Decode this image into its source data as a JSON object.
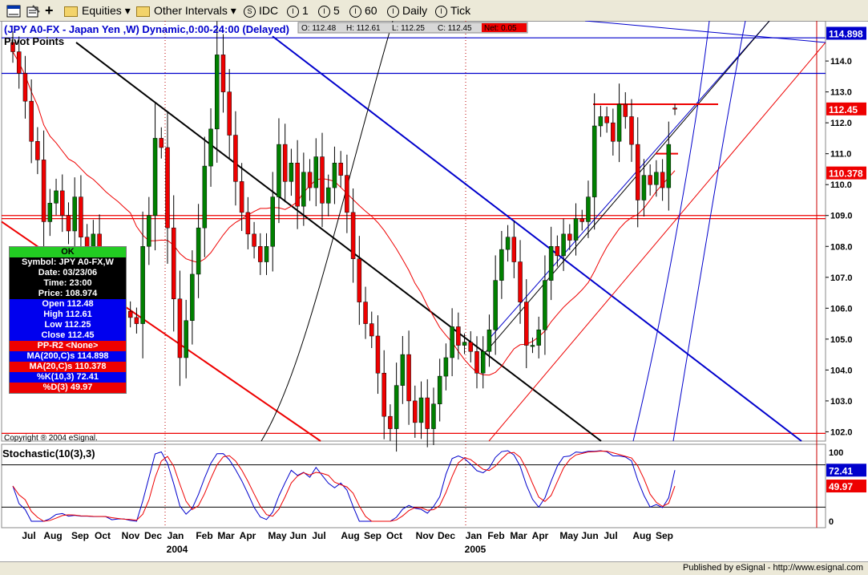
{
  "toolbar": {
    "equities": "Equities",
    "other_intervals": "Other Intervals",
    "idc": "IDC",
    "i1": "1",
    "i5": "5",
    "i60": "60",
    "daily": "Daily",
    "tick": "Tick",
    "s_glyph": "S",
    "i_glyph": "I"
  },
  "chart": {
    "title": "(JPY A0-FX - Japan Yen  ,W) Dynamic,0:00-24:00 (Delayed)",
    "study": "Pivot Points",
    "ohlc": {
      "o": "O: 112.48",
      "h": "H: 112.61",
      "l": "L: 112.25",
      "c": "C: 112.45",
      "net": "Net: 0.05"
    },
    "copyright": "Copyright ® 2004 eSignal.",
    "price_ticks": [
      "114.0",
      "113.0",
      "112.0",
      "111.0",
      "110.0",
      "109.0",
      "108.0",
      "107.0",
      "106.0",
      "105.0",
      "104.0",
      "103.0",
      "102.0"
    ],
    "price_labels": {
      "ma200": "114.898",
      "last": "112.45",
      "ma20": "110.378"
    },
    "stoch_title": "Stochastic(10(3),3)",
    "stoch_ticks": [
      "100",
      "0"
    ],
    "stoch_labels": {
      "k": "72.41",
      "d": "49.97"
    },
    "months": [
      "Jul",
      "Aug",
      "Sep",
      "Oct",
      "Nov",
      "Dec",
      "Jan",
      "Feb",
      "Mar",
      "Apr",
      "May",
      "Jun",
      "Jul",
      "Aug",
      "Sep",
      "Oct",
      "Nov",
      "Dec",
      "Jan",
      "Feb",
      "Mar",
      "Apr",
      "May",
      "Jun",
      "Jul",
      "Aug",
      "Sep"
    ],
    "years": [
      "2004",
      "2005"
    ]
  },
  "datawindow": {
    "ok": "OK",
    "symbol": "Symbol: JPY A0-FX,W",
    "date": "Date: 03/23/06",
    "time": "Time: 23:00",
    "price": "Price: 108.974",
    "open": "Open 112.48",
    "high": "High 112.61",
    "low": "Low 112.25",
    "close": "Close 112.45",
    "pp": "PP-R2 <None>",
    "ma200": "MA(200,C)s 114.898",
    "ma20": "MA(20,C)s 110.378",
    "k": "%K(10,3) 72.41",
    "d": "%D(3) 49.97"
  },
  "status": {
    "published": "Published by eSignal - http://www.esignal.com"
  },
  "colors": {
    "up": "#008000",
    "down": "#ee0000",
    "blue": "#0000cc",
    "red": "#ee0000",
    "black": "#000000",
    "ma200": "#0000cc",
    "ma20": "#ee0000"
  },
  "chart_data": {
    "type": "candlestick",
    "title": "(JPY A0-FX - Japan Yen  ,W) Dynamic,0:00-24:00 (Delayed)",
    "x_range": [
      "2003-07",
      "2005-09"
    ],
    "ylim": [
      101.7,
      115.3
    ],
    "stoch_ylim": [
      0,
      100
    ],
    "y_ticks": [
      102,
      103,
      104,
      105,
      106,
      107,
      108,
      109,
      110,
      111,
      112,
      113,
      114
    ],
    "closes": [
      114.3,
      113.6,
      112.7,
      111.4,
      110.8,
      108.8,
      109.4,
      109.8,
      109.0,
      108.5,
      109.6,
      108.3,
      107.8,
      108.4,
      107.3,
      106.7,
      106.9,
      106.8,
      105.9,
      105.7,
      105.5,
      108.0,
      109.0,
      111.5,
      111.2,
      108.6,
      106.3,
      104.4,
      105.6,
      107.1,
      108.6,
      110.6,
      111.8,
      114.2,
      113.0,
      111.6,
      110.1,
      109.1,
      108.4,
      108.0,
      107.5,
      108.0,
      109.6,
      111.3,
      110.1,
      110.7,
      109.3,
      110.4,
      109.9,
      110.9,
      109.4,
      109.9,
      110.7,
      110.3,
      109.1,
      107.6,
      106.2,
      105.5,
      105.1,
      103.9,
      102.5,
      102.1,
      103.5,
      104.5,
      103.0,
      102.3,
      103.1,
      102.1,
      102.9,
      103.8,
      104.4,
      105.4,
      104.8,
      104.9,
      104.6,
      103.9,
      104.6,
      105.3,
      106.9,
      107.9,
      108.3,
      107.5,
      106.2,
      104.8,
      104.8,
      105.3,
      106.9,
      108.0,
      107.7,
      108.4,
      108.2,
      108.9,
      108.8,
      109.6,
      111.9,
      112.2,
      112.0,
      111.4,
      112.6,
      112.2,
      111.3,
      109.5,
      110.3,
      110.0,
      110.4,
      109.9,
      111.3,
      112.45
    ],
    "highs_lows": {
      "last_high": 112.61,
      "last_low": 112.25,
      "last_open": 112.48
    },
    "pivot_lines": [
      114.75,
      113.6,
      109.0,
      108.9,
      101.95
    ],
    "resistance_segment": {
      "y": 112.6
    },
    "support_segment": {
      "y": 111.0
    },
    "ma200_last": 114.898,
    "ma20_last": 110.378,
    "stoch_k_last": 72.41,
    "stoch_d_last": 49.97,
    "stoch_levels": [
      80,
      20
    ]
  }
}
